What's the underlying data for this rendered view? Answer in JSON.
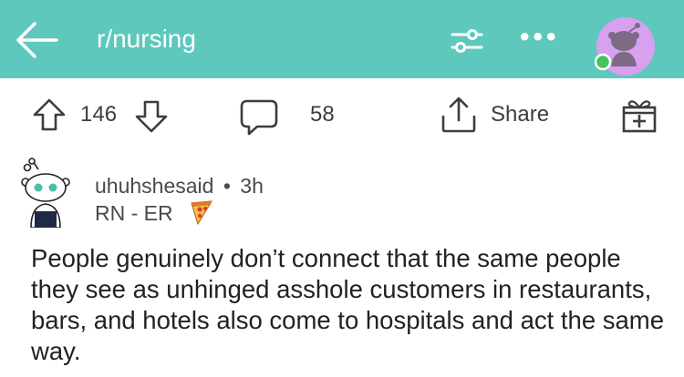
{
  "header": {
    "back_icon": "arrow-left-icon",
    "subreddit": "r/nursing",
    "filter_icon": "sliders-icon",
    "more_icon": "more-dots-icon",
    "more_label": "•••",
    "avatar_icon": "user-avatar-icon",
    "online_status_color": "#46c35b"
  },
  "actions": {
    "upvote_icon": "arrow-up-icon",
    "score": "146",
    "downvote_icon": "arrow-down-icon",
    "comment_icon": "comment-bubble-icon",
    "comment_count": "58",
    "share_icon": "share-icon",
    "share_label": "Share",
    "award_icon": "gift-icon"
  },
  "post": {
    "avatar_icon": "snoo-avatar-icon",
    "username": "uhuhshesaid",
    "separator": "•",
    "age": "3h",
    "flair": "RN - ER",
    "flair_icon": "pizza-icon",
    "body": "People genuinely don’t connect that the same people they see as unhinged asshole customers in restaurants, bars, and hotels also come to hospitals and act the same way."
  },
  "colors": {
    "header_bg": "#5ec8bd",
    "header_fg": "#ffffff",
    "avatar_bg": "#d7a1f0"
  }
}
